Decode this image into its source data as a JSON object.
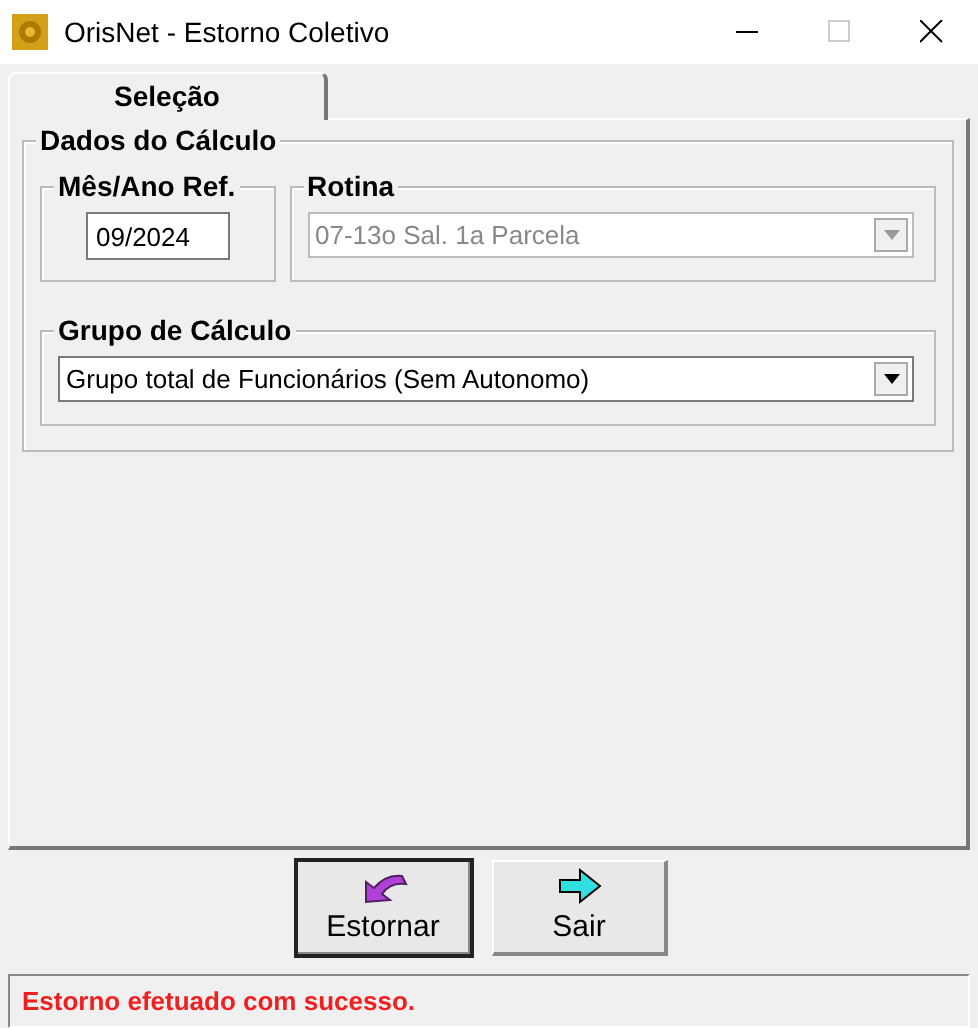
{
  "window": {
    "title": "OrisNet - Estorno Coletivo"
  },
  "tabs": [
    {
      "label": "Seleção",
      "selected": true
    }
  ],
  "group": {
    "title": "Dados do Cálculo",
    "month": {
      "label": "Mês/Ano Ref.",
      "value": "09/2024"
    },
    "routine": {
      "label": "Rotina",
      "value": "07-13o Sal. 1a Parcela",
      "disabled": true
    },
    "calc_group": {
      "label": "Grupo de Cálculo",
      "value": "Grupo total de Funcionários (Sem Autonomo)",
      "disabled": false
    }
  },
  "buttons": [
    {
      "label": "Estornar",
      "kind": "undo",
      "focused": true
    },
    {
      "label": "Sair",
      "kind": "exit",
      "focused": false
    }
  ],
  "status_bar": {
    "message": "Estorno efetuado com sucesso."
  }
}
